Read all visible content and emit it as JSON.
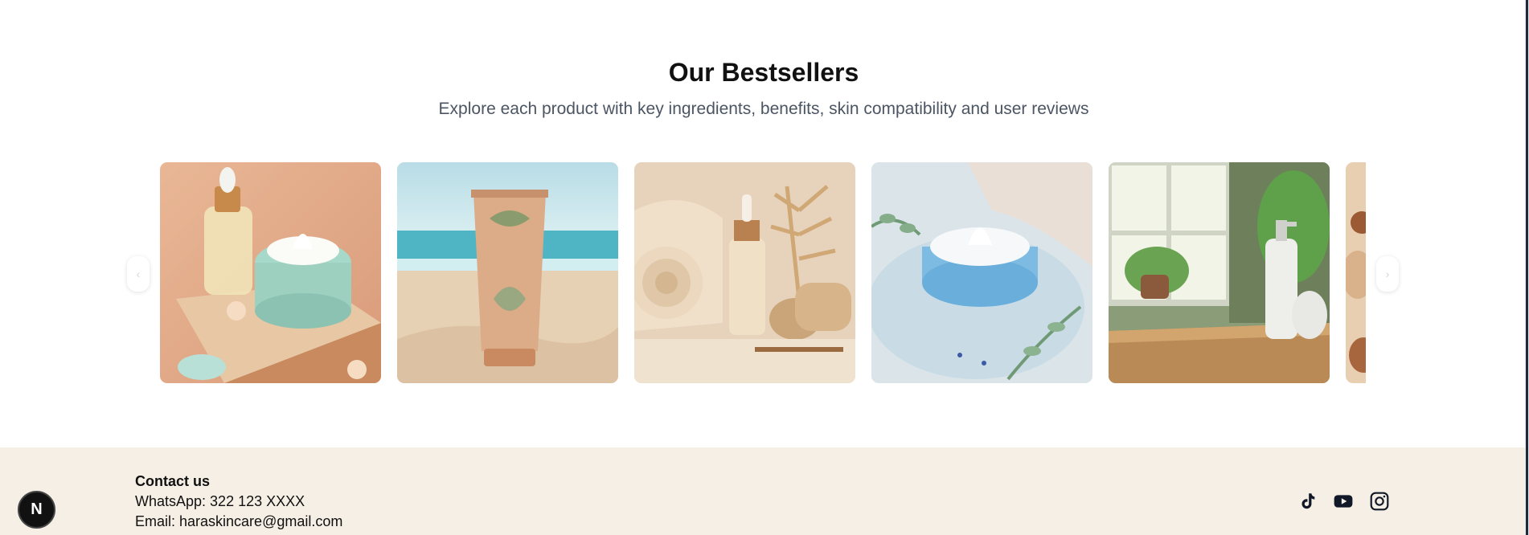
{
  "section": {
    "title": "Our Bestsellers",
    "subtitle": "Explore each product with key ingredients, benefits, skin compatibility and user reviews"
  },
  "carousel": {
    "prev_icon": "chevron-left-icon",
    "next_icon": "chevron-right-icon",
    "products": [
      {
        "image": "serum-and-cream-jar-on-wood"
      },
      {
        "image": "lotion-tube-on-beach"
      },
      {
        "image": "dropper-bottle-with-fern"
      },
      {
        "image": "blue-cream-jar-with-eucalyptus"
      },
      {
        "image": "pump-bottle-by-window-plants"
      },
      {
        "image": "partial-product-image"
      }
    ]
  },
  "footer": {
    "contact_title": "Contact us",
    "whatsapp": "WhatsApp: 322 123 XXXX",
    "email": "Email: haraskincare@gmail.com",
    "social_icons": [
      "tiktok-icon",
      "youtube-icon",
      "instagram-icon"
    ]
  },
  "badge": {
    "letter": "N"
  },
  "colors": {
    "footer_bg": "#f6efe5",
    "subtitle": "#4b5563",
    "text": "#111111"
  }
}
